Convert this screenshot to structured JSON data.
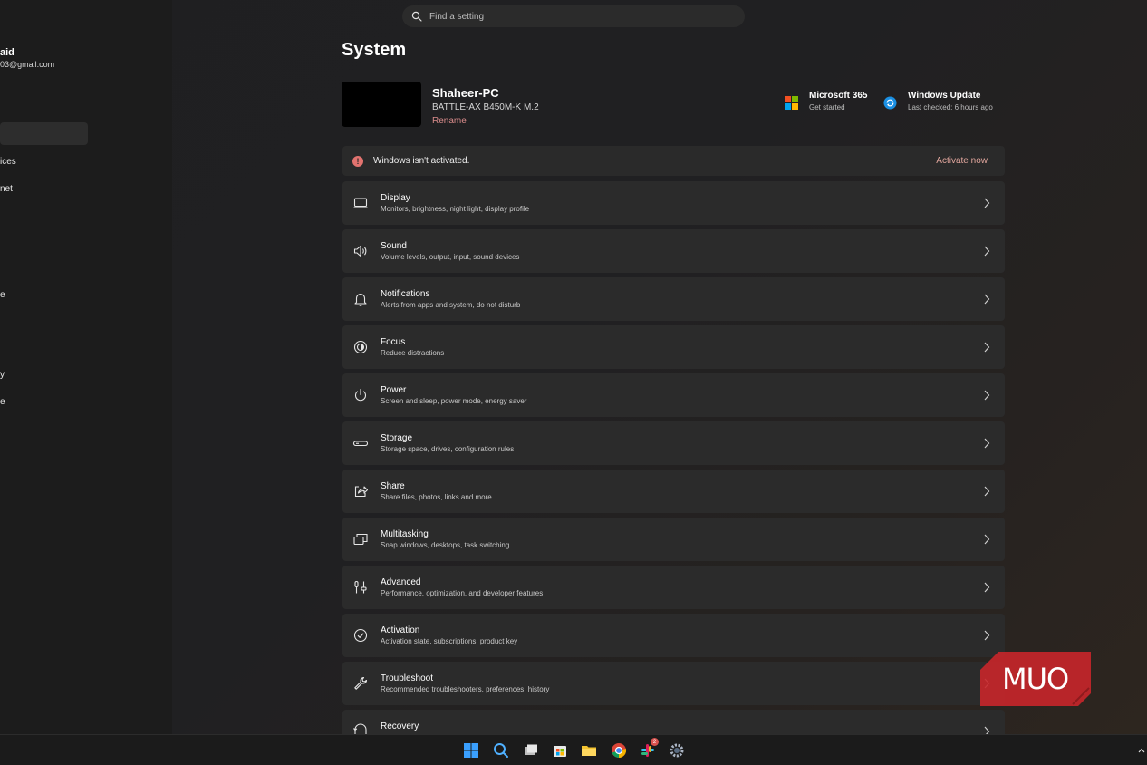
{
  "search": {
    "placeholder": "Find a setting"
  },
  "account": {
    "name": "aid",
    "email": "03@gmail.com"
  },
  "sidebar": {
    "items": [
      {
        "label": "ices"
      },
      {
        "label": "net"
      },
      {
        "label": "e"
      },
      {
        "label": "y"
      },
      {
        "label": "e"
      }
    ]
  },
  "page": {
    "title": "System"
  },
  "device": {
    "name": "Shaheer-PC",
    "model": "BATTLE-AX B450M-K M.2",
    "rename": "Rename"
  },
  "quick_links": [
    {
      "title": "Microsoft 365",
      "subtitle": "Get started"
    },
    {
      "title": "Windows Update",
      "subtitle": "Last checked: 6 hours ago"
    }
  ],
  "activation_banner": {
    "message": "Windows isn't activated.",
    "action": "Activate now"
  },
  "settings": [
    {
      "title": "Display",
      "desc": "Monitors, brightness, night light, display profile",
      "icon": "display-icon"
    },
    {
      "title": "Sound",
      "desc": "Volume levels, output, input, sound devices",
      "icon": "speaker-icon"
    },
    {
      "title": "Notifications",
      "desc": "Alerts from apps and system, do not disturb",
      "icon": "bell-icon"
    },
    {
      "title": "Focus",
      "desc": "Reduce distractions",
      "icon": "focus-icon"
    },
    {
      "title": "Power",
      "desc": "Screen and sleep, power mode, energy saver",
      "icon": "power-icon"
    },
    {
      "title": "Storage",
      "desc": "Storage space, drives, configuration rules",
      "icon": "storage-icon"
    },
    {
      "title": "Share",
      "desc": "Share files, photos, links and more",
      "icon": "share-icon"
    },
    {
      "title": "Multitasking",
      "desc": "Snap windows, desktops, task switching",
      "icon": "multitasking-icon"
    },
    {
      "title": "Advanced",
      "desc": "Performance, optimization, and developer features",
      "icon": "advanced-icon"
    },
    {
      "title": "Activation",
      "desc": "Activation state, subscriptions, product key",
      "icon": "check-circle-icon"
    },
    {
      "title": "Troubleshoot",
      "desc": "Recommended troubleshooters, preferences, history",
      "icon": "wrench-icon"
    },
    {
      "title": "Recovery",
      "desc": "",
      "icon": "recovery-icon"
    }
  ],
  "taskbar": {
    "badge_count": "2"
  },
  "watermark": {
    "text": "MUO"
  },
  "colors": {
    "accent_link": "#d98b8b",
    "warning": "#e2736f",
    "watermark": "#c8262a"
  }
}
